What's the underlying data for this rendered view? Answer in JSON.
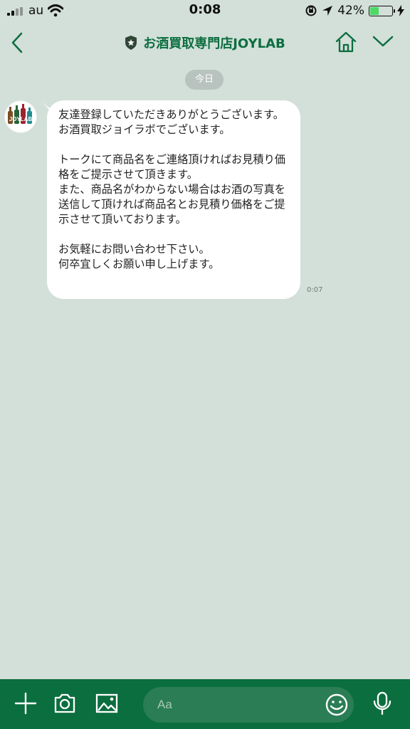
{
  "status_bar": {
    "carrier": "au",
    "time": "0:08",
    "battery_percent": "42%",
    "battery_level": 0.42,
    "icons": [
      "signal-icon",
      "wifi-icon",
      "orientation-lock-icon",
      "location-icon",
      "battery-icon",
      "charging-icon"
    ]
  },
  "header": {
    "title": "お酒買取専門店JOYLAB",
    "icons": [
      "chevron-left-icon",
      "shield-star-icon",
      "home-icon",
      "chevron-down-icon"
    ]
  },
  "chat": {
    "date_label": "今日",
    "messages": [
      {
        "avatar_text": "JOYLAB",
        "text": "友達登録していただきありがとうございます。\nお酒買取ジョイラボでございます。\n\nトークにて商品名をご連絡頂ければお見積り価格をご提示させて頂きます。\nまた、商品名がわからない場合はお酒の写真を送信して頂ければ商品名とお見積り価格をご提示させて頂いております。\n\nお気軽にお問い合わせ下さい。\n何卒宜しくお願い申し上げます。",
        "time": "0:07"
      }
    ]
  },
  "composer": {
    "placeholder": "Aa",
    "icons": [
      "plus-icon",
      "camera-icon",
      "image-icon",
      "emoji-icon",
      "mic-icon"
    ]
  },
  "colors": {
    "background": "#d3dfd9",
    "brand_green": "#0b6e3f",
    "bubble": "#ffffff",
    "date_badge": "#b8c3bf",
    "battery_green": "#4cd964"
  }
}
